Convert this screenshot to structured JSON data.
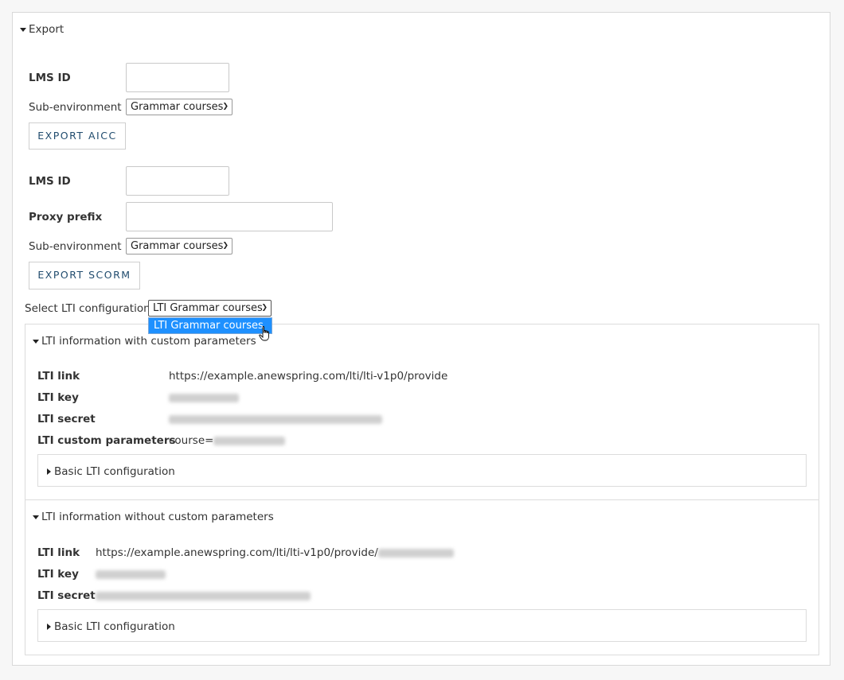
{
  "export": {
    "title": "Export",
    "aicc": {
      "lms_id_label": "LMS ID",
      "lms_id_value": "",
      "subenv_label": "Sub-environment",
      "subenv_value": "Grammar courses",
      "button_label": "EXPORT AICC"
    },
    "scorm": {
      "lms_id_label": "LMS ID",
      "lms_id_value": "",
      "proxy_label": "Proxy prefix",
      "proxy_value": "",
      "subenv_label": "Sub-environment",
      "subenv_value": "Grammar courses",
      "button_label": "EXPORT SCORM"
    },
    "lti_select": {
      "label": "Select LTI configuration",
      "value": "LTI Grammar courses",
      "options": [
        "LTI Grammar courses"
      ]
    },
    "lti_custom": {
      "title": "LTI information with custom parameters",
      "link_label": "LTI link",
      "link_value": "https://example.anewspring.com/lti/lti-v1p0/provide",
      "key_label": "LTI key",
      "secret_label": "LTI secret",
      "custom_label": "LTI custom parameters",
      "custom_prefix": "course=",
      "basic_title": "Basic LTI configuration"
    },
    "lti_nocustom": {
      "title": "LTI information without custom parameters",
      "link_label": "LTI link",
      "link_value": "https://example.anewspring.com/lti/lti-v1p0/provide/",
      "key_label": "LTI key",
      "secret_label": "LTI secret",
      "basic_title": "Basic LTI configuration"
    }
  },
  "colors": {
    "button_text": "#214c6e",
    "dropdown_highlight": "#1e90ff"
  }
}
